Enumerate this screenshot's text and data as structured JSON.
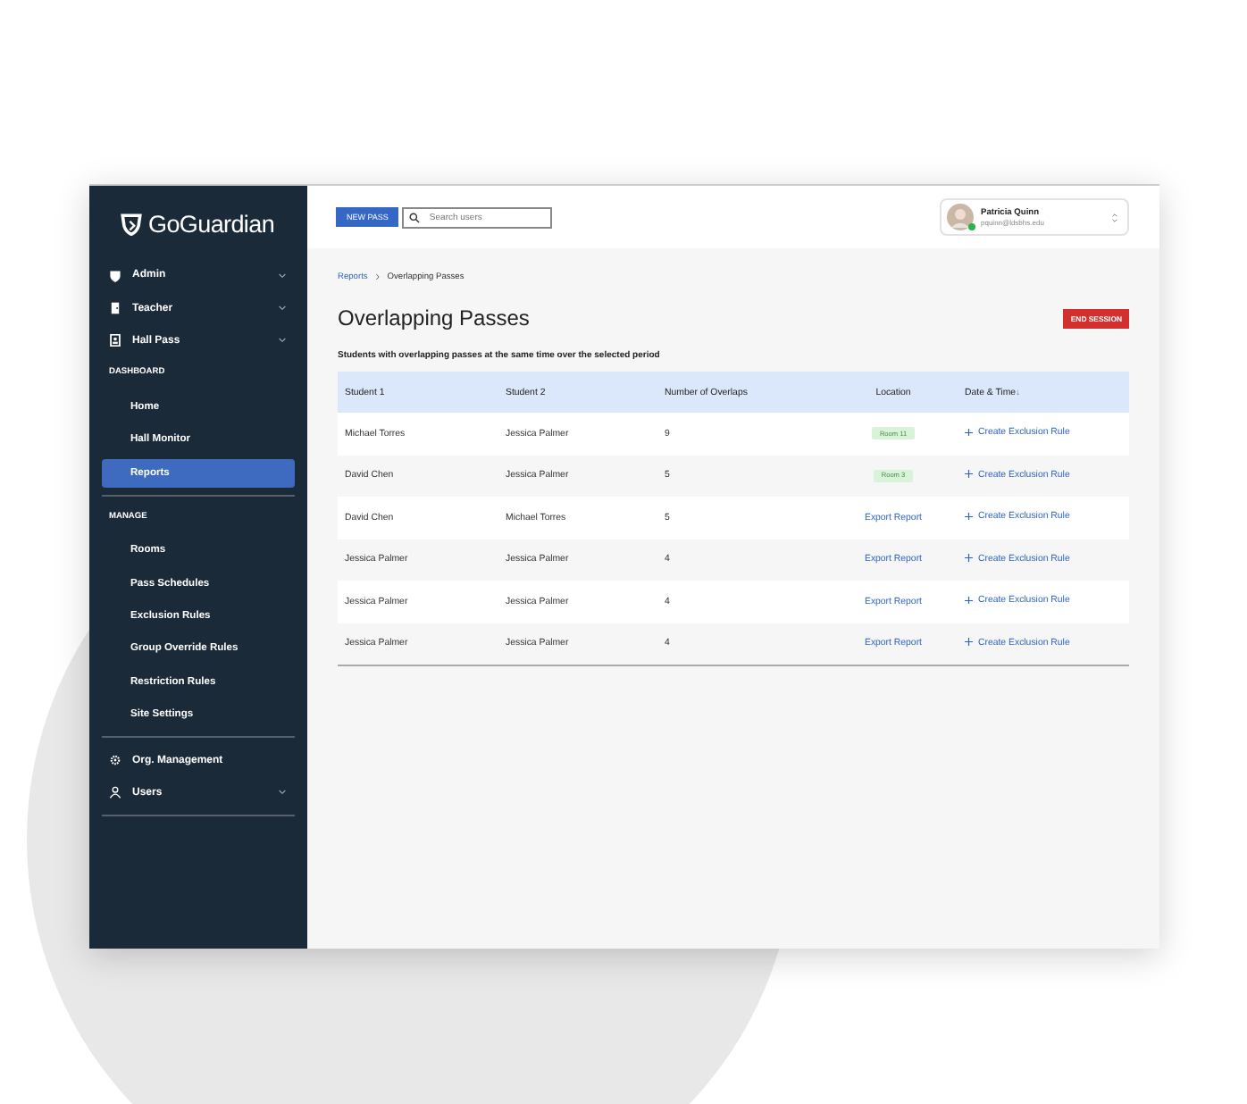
{
  "logo": {
    "text": "GoGuardian"
  },
  "sidebar": {
    "items": [
      {
        "kind": "group",
        "label": "Admin",
        "expandable": true
      },
      {
        "kind": "group",
        "label": "Teacher",
        "expandable": true
      },
      {
        "kind": "group",
        "label": "Hall Pass",
        "expandable": true
      },
      {
        "kind": "heading",
        "label": "DASHBOARD"
      },
      {
        "kind": "link",
        "label": "Home",
        "selected": false
      },
      {
        "kind": "link",
        "label": "Hall Monitor",
        "selected": false
      },
      {
        "kind": "link",
        "label": "Reports",
        "selected": true
      },
      {
        "kind": "divider"
      },
      {
        "kind": "heading",
        "label": "MANAGE"
      },
      {
        "kind": "link",
        "label": "Rooms",
        "selected": false
      },
      {
        "kind": "link",
        "label": "Pass Schedules",
        "selected": false
      },
      {
        "kind": "link",
        "label": "Exclusion Rules",
        "selected": false
      },
      {
        "kind": "link",
        "label": "Group Override Rules",
        "selected": false
      },
      {
        "kind": "link",
        "label": "Restriction Rules",
        "selected": false
      },
      {
        "kind": "link",
        "label": "Site Settings",
        "selected": false
      },
      {
        "kind": "divider"
      },
      {
        "kind": "group",
        "label": "Org. Management",
        "expandable": false
      },
      {
        "kind": "group",
        "label": "Users",
        "expandable": true
      },
      {
        "kind": "divider"
      }
    ]
  },
  "topbar": {
    "new_pass": "NEW PASS",
    "search": {
      "placeholder": "Search users"
    },
    "user": {
      "name": "Patricia Quinn",
      "email": "pquinn@ldsbhs.edu"
    }
  },
  "breadcrumb": [
    {
      "label": "Reports",
      "kind": "link"
    },
    {
      "label": "Overlapping Passes",
      "kind": "current"
    }
  ],
  "title": "Overlapping Passes",
  "end_session": "END SESSION",
  "subtitle": "Students with overlapping passes at the same time over the selected period",
  "table": {
    "columns": [
      "Student 1",
      "Student 2",
      "Number of Overlaps",
      "Location",
      "Date & Time"
    ],
    "sort_icon": "↓",
    "rows": [
      {
        "student_1": "Michael Torres",
        "student_2": "Jessica Palmer",
        "overlaps": "9",
        "location": {
          "kind": "badge",
          "text": "Room 11"
        },
        "action": "Create Exclusion Rule"
      },
      {
        "student_1": "David Chen",
        "student_2": "Jessica Palmer",
        "overlaps": "5",
        "location": {
          "kind": "badge",
          "text": "Room 3"
        },
        "action": "Create Exclusion Rule"
      },
      {
        "student_1": "David Chen",
        "student_2": "Michael Torres",
        "overlaps": "5",
        "location": {
          "kind": "link",
          "text": "Export Report"
        },
        "action": "Create Exclusion Rule"
      },
      {
        "student_1": "Jessica Palmer",
        "student_2": "Jessica Palmer",
        "overlaps": "4",
        "location": {
          "kind": "link",
          "text": "Export Report"
        },
        "action": "Create Exclusion Rule"
      },
      {
        "student_1": "Jessica Palmer",
        "student_2": "Jessica Palmer",
        "overlaps": "4",
        "location": {
          "kind": "link",
          "text": "Export Report"
        },
        "action": "Create Exclusion Rule"
      },
      {
        "student_1": "Jessica Palmer",
        "student_2": "Jessica Palmer",
        "overlaps": "4",
        "location": {
          "kind": "link",
          "text": "Export Report"
        },
        "action": "Create Exclusion Rule"
      }
    ]
  }
}
